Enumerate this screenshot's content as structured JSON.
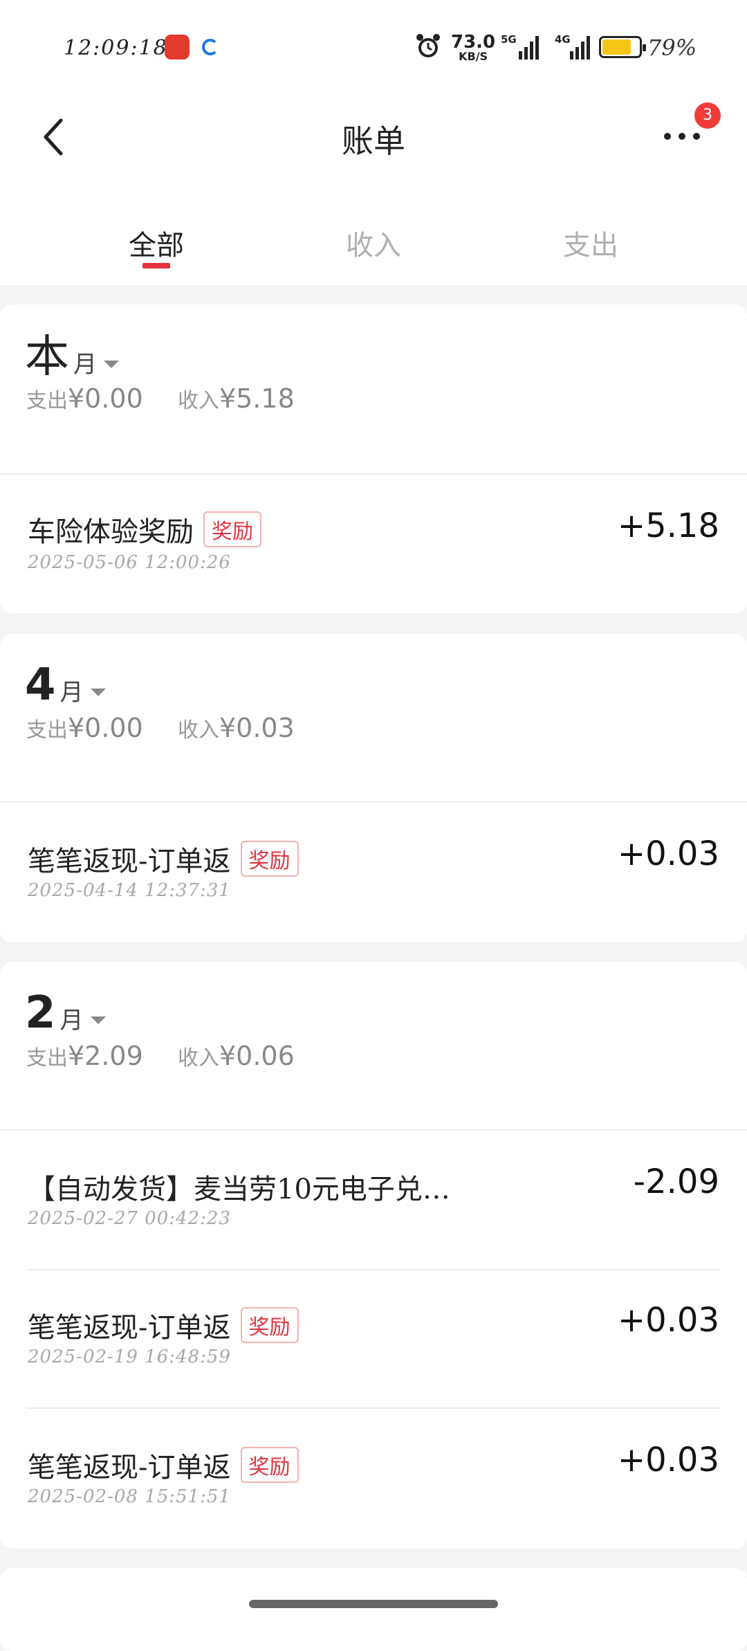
{
  "status": {
    "time": "12:09:18",
    "net_speed": "73.0",
    "net_unit": "KB/S",
    "sig1": "5G",
    "sig2": "4G",
    "battery_pct": "79%",
    "battery_level": 0.79
  },
  "nav": {
    "title": "账单",
    "badge": "3"
  },
  "tabs": [
    {
      "label": "全部"
    },
    {
      "label": "收入"
    },
    {
      "label": "支出"
    }
  ],
  "months": [
    {
      "num": "本",
      "unit": "月",
      "out_label": "支出",
      "out_amt": "¥0.00",
      "in_label": "收入",
      "in_amt": "¥5.18",
      "rows": [
        {
          "title": "车险体验奖励",
          "tag": "奖励",
          "date": "2025-05-06  12:00:26",
          "amount": "+5.18"
        }
      ]
    },
    {
      "num": "4",
      "unit": "月",
      "out_label": "支出",
      "out_amt": "¥0.00",
      "in_label": "收入",
      "in_amt": "¥0.03",
      "rows": [
        {
          "title": "笔笔返现-订单返",
          "tag": "奖励",
          "date": "2025-04-14  12:37:31",
          "amount": "+0.03"
        }
      ]
    },
    {
      "num": "2",
      "unit": "月",
      "out_label": "支出",
      "out_amt": "¥2.09",
      "in_label": "收入",
      "in_amt": "¥0.06",
      "rows": [
        {
          "title": "【自动发货】麦当劳10元电子兑…",
          "tag": "",
          "date": "2025-02-27  00:42:23",
          "amount": "-2.09"
        },
        {
          "title": "笔笔返现-订单返",
          "tag": "奖励",
          "date": "2025-02-19  16:48:59",
          "amount": "+0.03"
        },
        {
          "title": "笔笔返现-订单返",
          "tag": "奖励",
          "date": "2025-02-08  15:51:51",
          "amount": "+0.03"
        }
      ]
    }
  ]
}
